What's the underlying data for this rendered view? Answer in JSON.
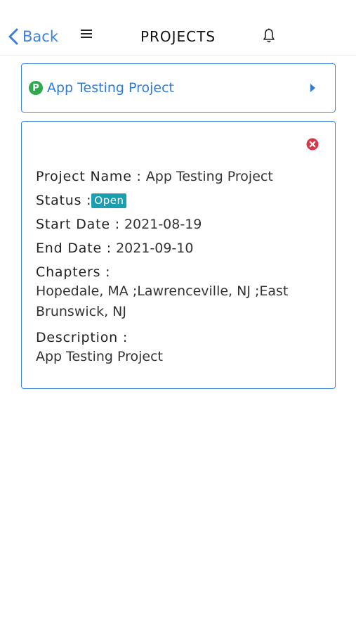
{
  "header": {
    "back_label": "Back",
    "title": "PROJECTS"
  },
  "project_row": {
    "badge": "P",
    "name": "App Testing Project"
  },
  "details": {
    "project_name_label": "Project Name :",
    "project_name_value": "App Testing Project",
    "status_label": "Status :",
    "status_value": "Open",
    "start_date_label": "Start Date :",
    "start_date_value": "2021-08-19",
    "end_date_label": "End Date :",
    "end_date_value": "2021-09-10",
    "chapters_label": "Chapters :",
    "chapters_value": "Hopedale, MA ;Lawrenceville, NJ ;East Brunswick, NJ",
    "description_label": "Description :",
    "description_value": "App Testing Project"
  },
  "colors": {
    "accent": "#2e7bd8",
    "status_badge": "#1a9fb0",
    "project_badge": "#2fa84f",
    "close": "#d9364a"
  }
}
